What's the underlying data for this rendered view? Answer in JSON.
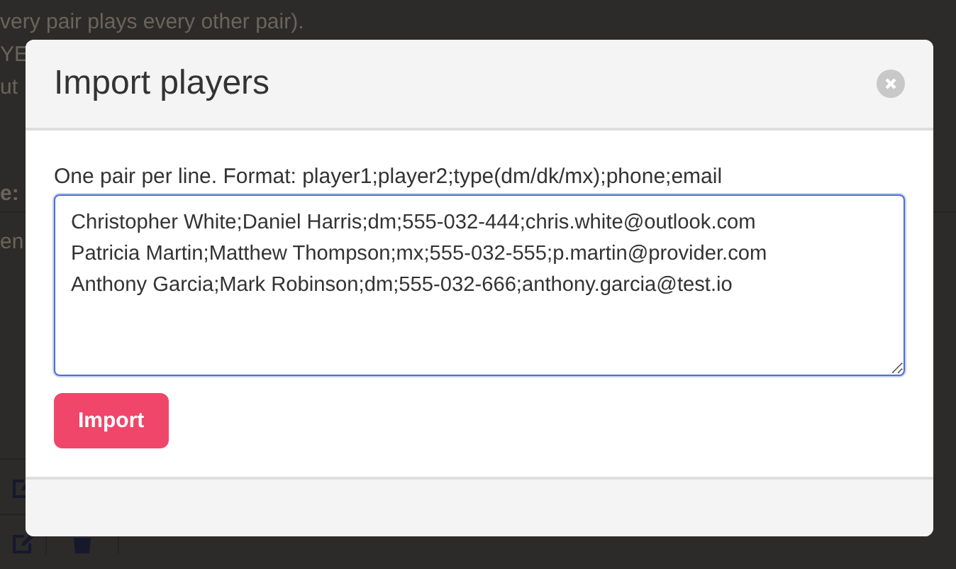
{
  "background_page": {
    "lines": [
      "very pair plays every other pair).",
      "YE",
      "ut"
    ],
    "label": "e:",
    "cell": "en"
  },
  "modal": {
    "title": "Import players",
    "instructions": "One pair per line. Format: player1;player2;type(dm/dk/mx);phone;email",
    "textarea_lines": [
      "Christopher White;Daniel Harris;dm;555-032-444;chris.white@outlook.com",
      "Patricia Martin;Matthew Thompson;mx;555-032-555;p.martin@provider.com",
      "Anthony Garcia;Mark Robinson;dm;555-032-666;anthony.garcia@test.io"
    ],
    "import_button": "Import"
  }
}
